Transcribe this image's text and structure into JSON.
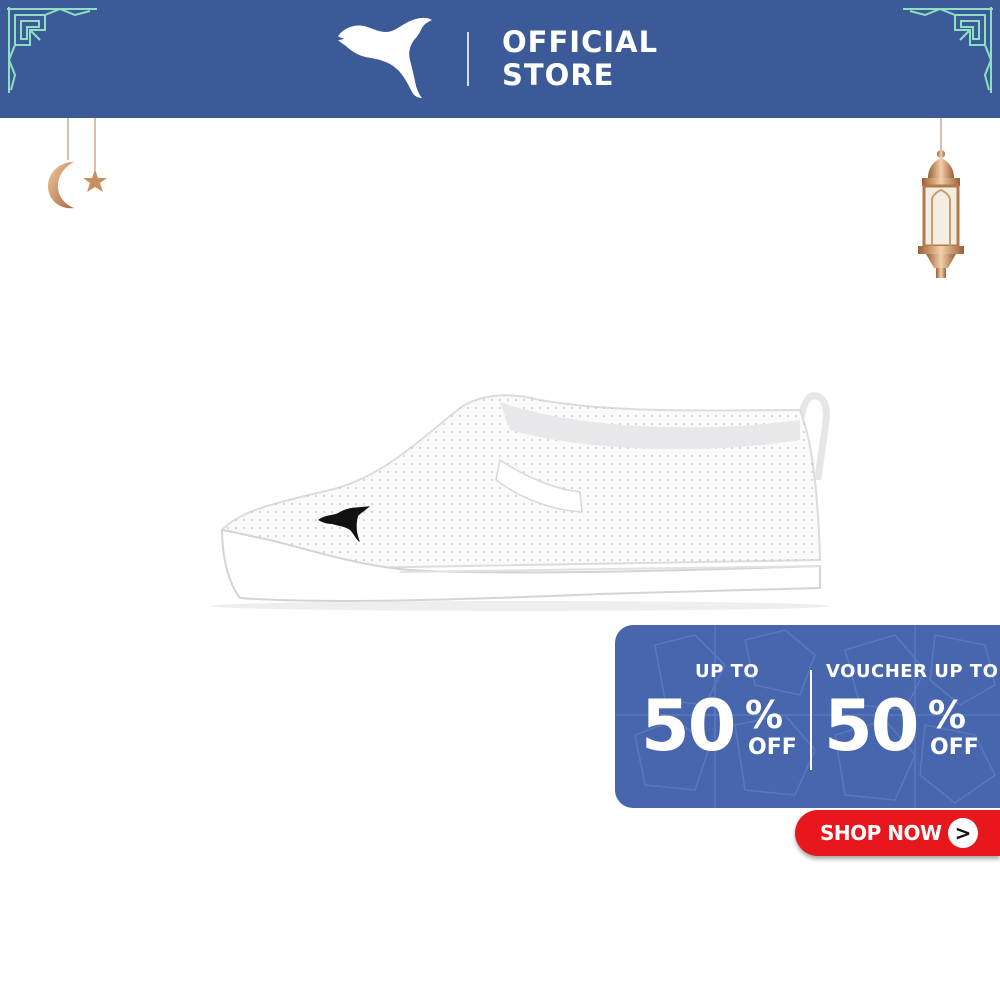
{
  "header": {
    "store_line1": "OFFICIAL",
    "store_line2": "STORE",
    "background_color": "#3d5a98"
  },
  "logo": {
    "icon": "puma-leaping-cat-icon",
    "color": "#ffffff"
  },
  "decorations": {
    "left_corner_icon": "geometric-corner-ornament-icon",
    "crescent_icon": "crescent-moon-icon",
    "star_icon": "star-icon",
    "lantern_icon": "hanging-lantern-icon",
    "accent_color": "#c98f5f",
    "ornament_color": "#8fe0c2"
  },
  "product": {
    "image_icon": "white-slip-on-sneaker-icon"
  },
  "promo": {
    "left_label": "UP TO",
    "left_value": "50",
    "left_percent": "%",
    "left_off": "OFF",
    "right_label": "VOUCHER UP TO",
    "right_value": "50",
    "right_percent": "%",
    "right_off": "OFF",
    "background_color": "#4766ad"
  },
  "cta": {
    "label": "SHOP NOW",
    "arrow": ">",
    "background_color": "#e8161d"
  }
}
